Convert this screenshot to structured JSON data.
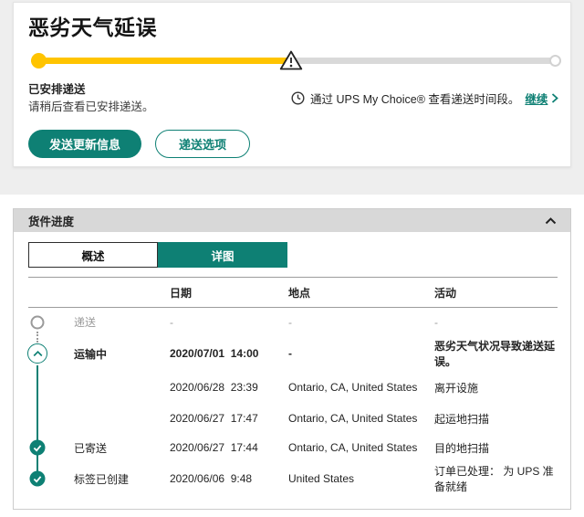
{
  "colors": {
    "teal": "#0e8074",
    "yellow": "#ffc400",
    "track_gray": "#d9d9d9"
  },
  "icons": {
    "progress_warning": "warning-triangle-icon",
    "info_clock": "clock-icon",
    "link_arrow": "chevron-right-icon",
    "panel_collapse": "chevron-up-icon",
    "row_expand": "chevron-up-circle-icon",
    "row_done": "check-circle-icon",
    "row_pending": "empty-circle-icon"
  },
  "alert_card": {
    "title": "恶劣天气延误",
    "progress": {
      "percent": 49
    },
    "status_title": "已安排递送",
    "status_subtitle": "请稍后查看已安排递送。",
    "mychoice_text": "通过 UPS My Choice® 查看递送时间段。",
    "mychoice_link": "继续",
    "buttons": {
      "primary": "发送更新信息",
      "secondary": "递送选项"
    }
  },
  "progress_panel": {
    "title": "货件进度",
    "tabs": [
      {
        "label": "概述",
        "active": false
      },
      {
        "label": "详图",
        "active": true
      }
    ],
    "table": {
      "headers": {
        "date": "日期",
        "location": "地点",
        "activity": "活动"
      },
      "rows": [
        {
          "status": "递送",
          "date": "-",
          "location": "-",
          "activity": "-",
          "icon": "empty-circle",
          "muted": true,
          "bold": false
        },
        {
          "status": "运输中",
          "date": "2020/07/01  14:00",
          "location": "-",
          "activity": "恶劣天气状况导致递送延误。",
          "icon": "chevron-circle",
          "muted": false,
          "bold": true
        },
        {
          "status": "",
          "date": "2020/06/28  23:39",
          "location": "Ontario, CA, United States",
          "activity": "离开设施",
          "icon": "none",
          "muted": false,
          "bold": false
        },
        {
          "status": "",
          "date": "2020/06/27  17:47",
          "location": "Ontario, CA, United States",
          "activity": "起运地扫描",
          "icon": "none",
          "muted": false,
          "bold": false
        },
        {
          "status": "已寄送",
          "date": "2020/06/27  17:44",
          "location": "Ontario, CA, United States",
          "activity": "目的地扫描",
          "icon": "check",
          "muted": false,
          "bold": false
        },
        {
          "status": "标签已创建",
          "date": "2020/06/06  9:48",
          "location": "United States",
          "activity": "订单已处理： 为 UPS 准备就绪",
          "icon": "check",
          "muted": false,
          "bold": false
        }
      ]
    }
  }
}
